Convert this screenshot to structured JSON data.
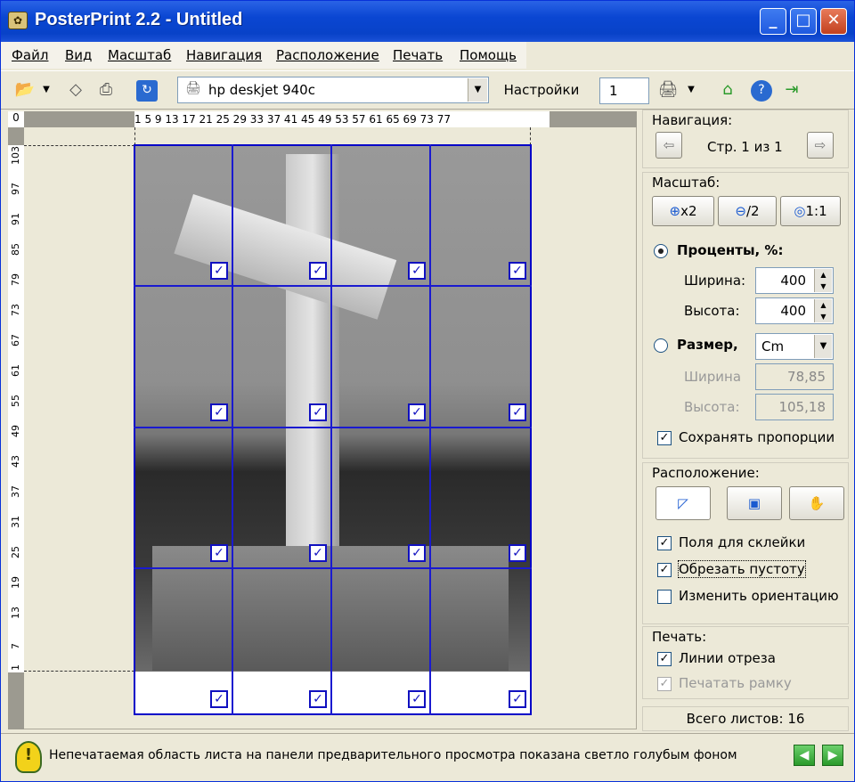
{
  "window": {
    "title": "PosterPrint 2.2 - Untitled",
    "min": "_",
    "max": "□",
    "close": "✕"
  },
  "menu": [
    "Файл",
    "Вид",
    "Масштаб",
    "Навигация",
    "Расположение",
    "Печать",
    "Помощь"
  ],
  "toolbar": {
    "printer": "hp deskjet 940c",
    "settings_label": "Настройки",
    "copies": "1"
  },
  "ruler": {
    "corner": "0",
    "top": "1  5  9  13 17 21 25 29 33 37 41 45 49 53 57 61 65 69 73 77",
    "left": [
      "103",
      "97",
      "91",
      "85",
      "79",
      "73",
      "67",
      "61",
      "55",
      "49",
      "43",
      "37",
      "31",
      "25",
      "19",
      "13",
      "7",
      "1"
    ]
  },
  "navigation": {
    "title": "Навигация:",
    "page": "Стр. 1 из 1",
    "prev": "⇦",
    "next": "⇨"
  },
  "scale": {
    "title": "Масштаб:",
    "zoom_in": "x2",
    "zoom_out": "/2",
    "zoom_reset": "1:1",
    "percent_label": "Проценты, %:",
    "width_label": "Ширина:",
    "width_val": "400",
    "height_label": "Высота:",
    "height_val": "400",
    "size_label": "Размер,",
    "unit": "Cm",
    "size_width_label": "Ширина",
    "size_width_val": "78,85",
    "size_height_label": "Высота:",
    "size_height_val": "105,18",
    "keep_ratio": "Сохранять пропорции"
  },
  "layout": {
    "title": "Расположение:",
    "glue_margins": "Поля для склейки",
    "crop_empty": "Обрезать пустоту",
    "change_orientation": "Изменить ориентацию"
  },
  "print": {
    "title": "Печать:",
    "cut_lines": "Линии отреза",
    "print_frame": "Печатать рамку"
  },
  "total": "Всего листов: 16",
  "status": {
    "message": "Непечатаемая область листа на панели предварительного просмотра показана светло голубым фоном"
  },
  "colors": {
    "grid": "#1a1ad0",
    "titlebar": "#0a46d2"
  },
  "icons": [
    "open-icon",
    "erase-icon",
    "print-icon",
    "refresh-icon",
    "printer-icon",
    "home-icon",
    "help-icon",
    "exit-icon",
    "warning-icon"
  ]
}
